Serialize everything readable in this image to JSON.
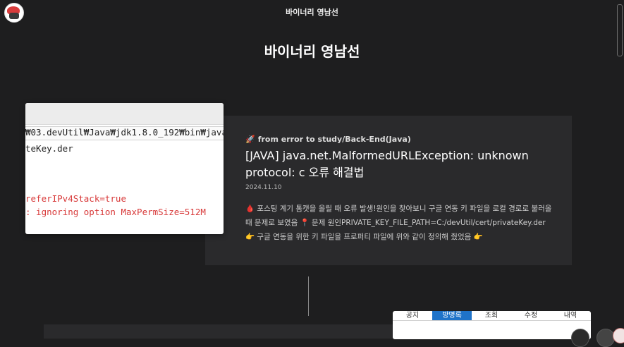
{
  "header": {
    "site_name": "바이너리 영남선"
  },
  "blog": {
    "title": "바이너리 영남선"
  },
  "post": {
    "category_icon": "rocket-icon",
    "category": "from error to study/Back-End(Java)",
    "title": "[JAVA] java.net.MalformedURLException: unknown protocol: c 오류 해결법",
    "date": "2024.11.10",
    "excerpt": "🩸 포스팅 계기 톰캣을 올릴 때 오류 발생!원인을 찾아보니 구글 연동 키 파일을 로컬 경로로 불러올 때 문제로 보였음   📍 문제 원인PRIVATE_KEY_FILE_PATH=C:/devUtil/cert/privateKey.der👉  구글 연동을 위한 키 파일을 프로퍼티 파일에 위와 같이 정의해 줬었음   👉"
  },
  "thumbnail": {
    "line1": "₩03.devUtil₩Java₩jdk1.8.0_192₩bin₩java",
    "line2": "teKey.der",
    "line3": "referIPv4Stack=true",
    "line4": ": ignoring option MaxPermSize=512M"
  },
  "widget": {
    "tabs": [
      "공지",
      "방명록",
      "조회",
      "수정",
      "내역"
    ]
  },
  "colors": {
    "background": "#1e1e1f",
    "card": "#2a2a2c",
    "accent_tab": "#1f73c9"
  }
}
